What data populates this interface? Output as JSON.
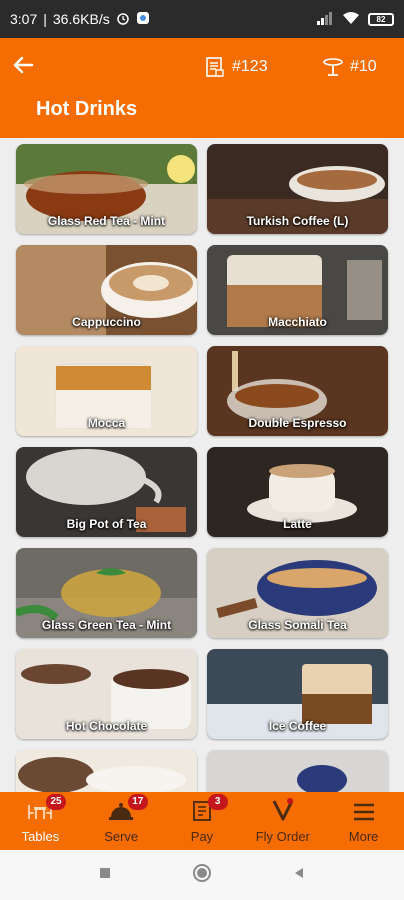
{
  "status_bar": {
    "time": "3:07",
    "speed": "36.6KB/s",
    "battery": "82"
  },
  "header": {
    "order_label": "#123",
    "table_label": "#10",
    "title": "Hot Drinks"
  },
  "products": [
    {
      "name": "Glass Red Tea - Mint"
    },
    {
      "name": "Turkish Coffee (L)"
    },
    {
      "name": "Cappuccino"
    },
    {
      "name": "Macchiato"
    },
    {
      "name": "Mocca"
    },
    {
      "name": "Double Espresso"
    },
    {
      "name": "Big Pot of Tea"
    },
    {
      "name": "Latte"
    },
    {
      "name": "Glass Green Tea - Mint"
    },
    {
      "name": "Glass Somali Tea"
    },
    {
      "name": "Hot Chocolate"
    },
    {
      "name": "Ice Coffee"
    },
    {
      "name": ""
    },
    {
      "name": ""
    }
  ],
  "bottom_nav": {
    "tables": {
      "label": "Tables",
      "badge": "25"
    },
    "serve": {
      "label": "Serve",
      "badge": "17"
    },
    "pay": {
      "label": "Pay",
      "badge": "3"
    },
    "fly_order": {
      "label": "Fly Order"
    },
    "more": {
      "label": "More"
    }
  },
  "colors": {
    "brand": "#f56c00",
    "badge": "#c4161c"
  }
}
